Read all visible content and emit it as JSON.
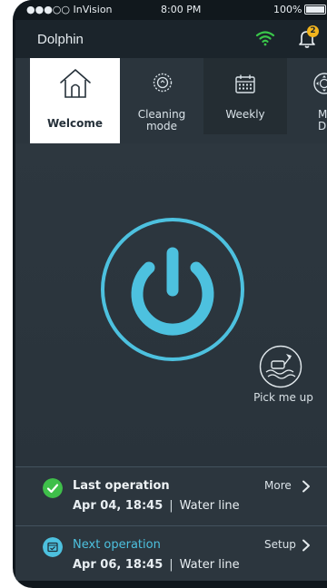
{
  "status_bar": {
    "carrier": "●●●○○ InVision",
    "time": "8:00 PM",
    "battery": "100%"
  },
  "app_bar": {
    "title": "Dolphin",
    "notification_count": "2"
  },
  "tabs": [
    {
      "label": "Welcome",
      "icon": "home-icon",
      "selected": true
    },
    {
      "label": "Cleaning mode",
      "label_line1": "Cleaning",
      "label_line2": "mode",
      "icon": "cleaning-mode-icon"
    },
    {
      "label": "Weekly",
      "icon": "calendar-icon"
    },
    {
      "label": "Manual Drive",
      "label_line1": "Man",
      "label_line2": "Dri",
      "icon": "joystick-icon"
    }
  ],
  "main": {
    "pick_up_label": "Pick me up",
    "power_icon": "power-icon"
  },
  "last_operation": {
    "label": "Last operation",
    "date": "Apr 04, 18:45",
    "separator": "|",
    "mode": "Water line",
    "action": "More"
  },
  "next_operation": {
    "label": "Next operation",
    "date": "Apr 06, 18:45",
    "separator": "|",
    "mode": "Water line",
    "action": "Setup"
  },
  "colors": {
    "accent": "#4dc1df",
    "wifi": "#3ac74a",
    "success": "#3fbf4a",
    "badge": "#f3b51d",
    "background": "#2b353d"
  }
}
